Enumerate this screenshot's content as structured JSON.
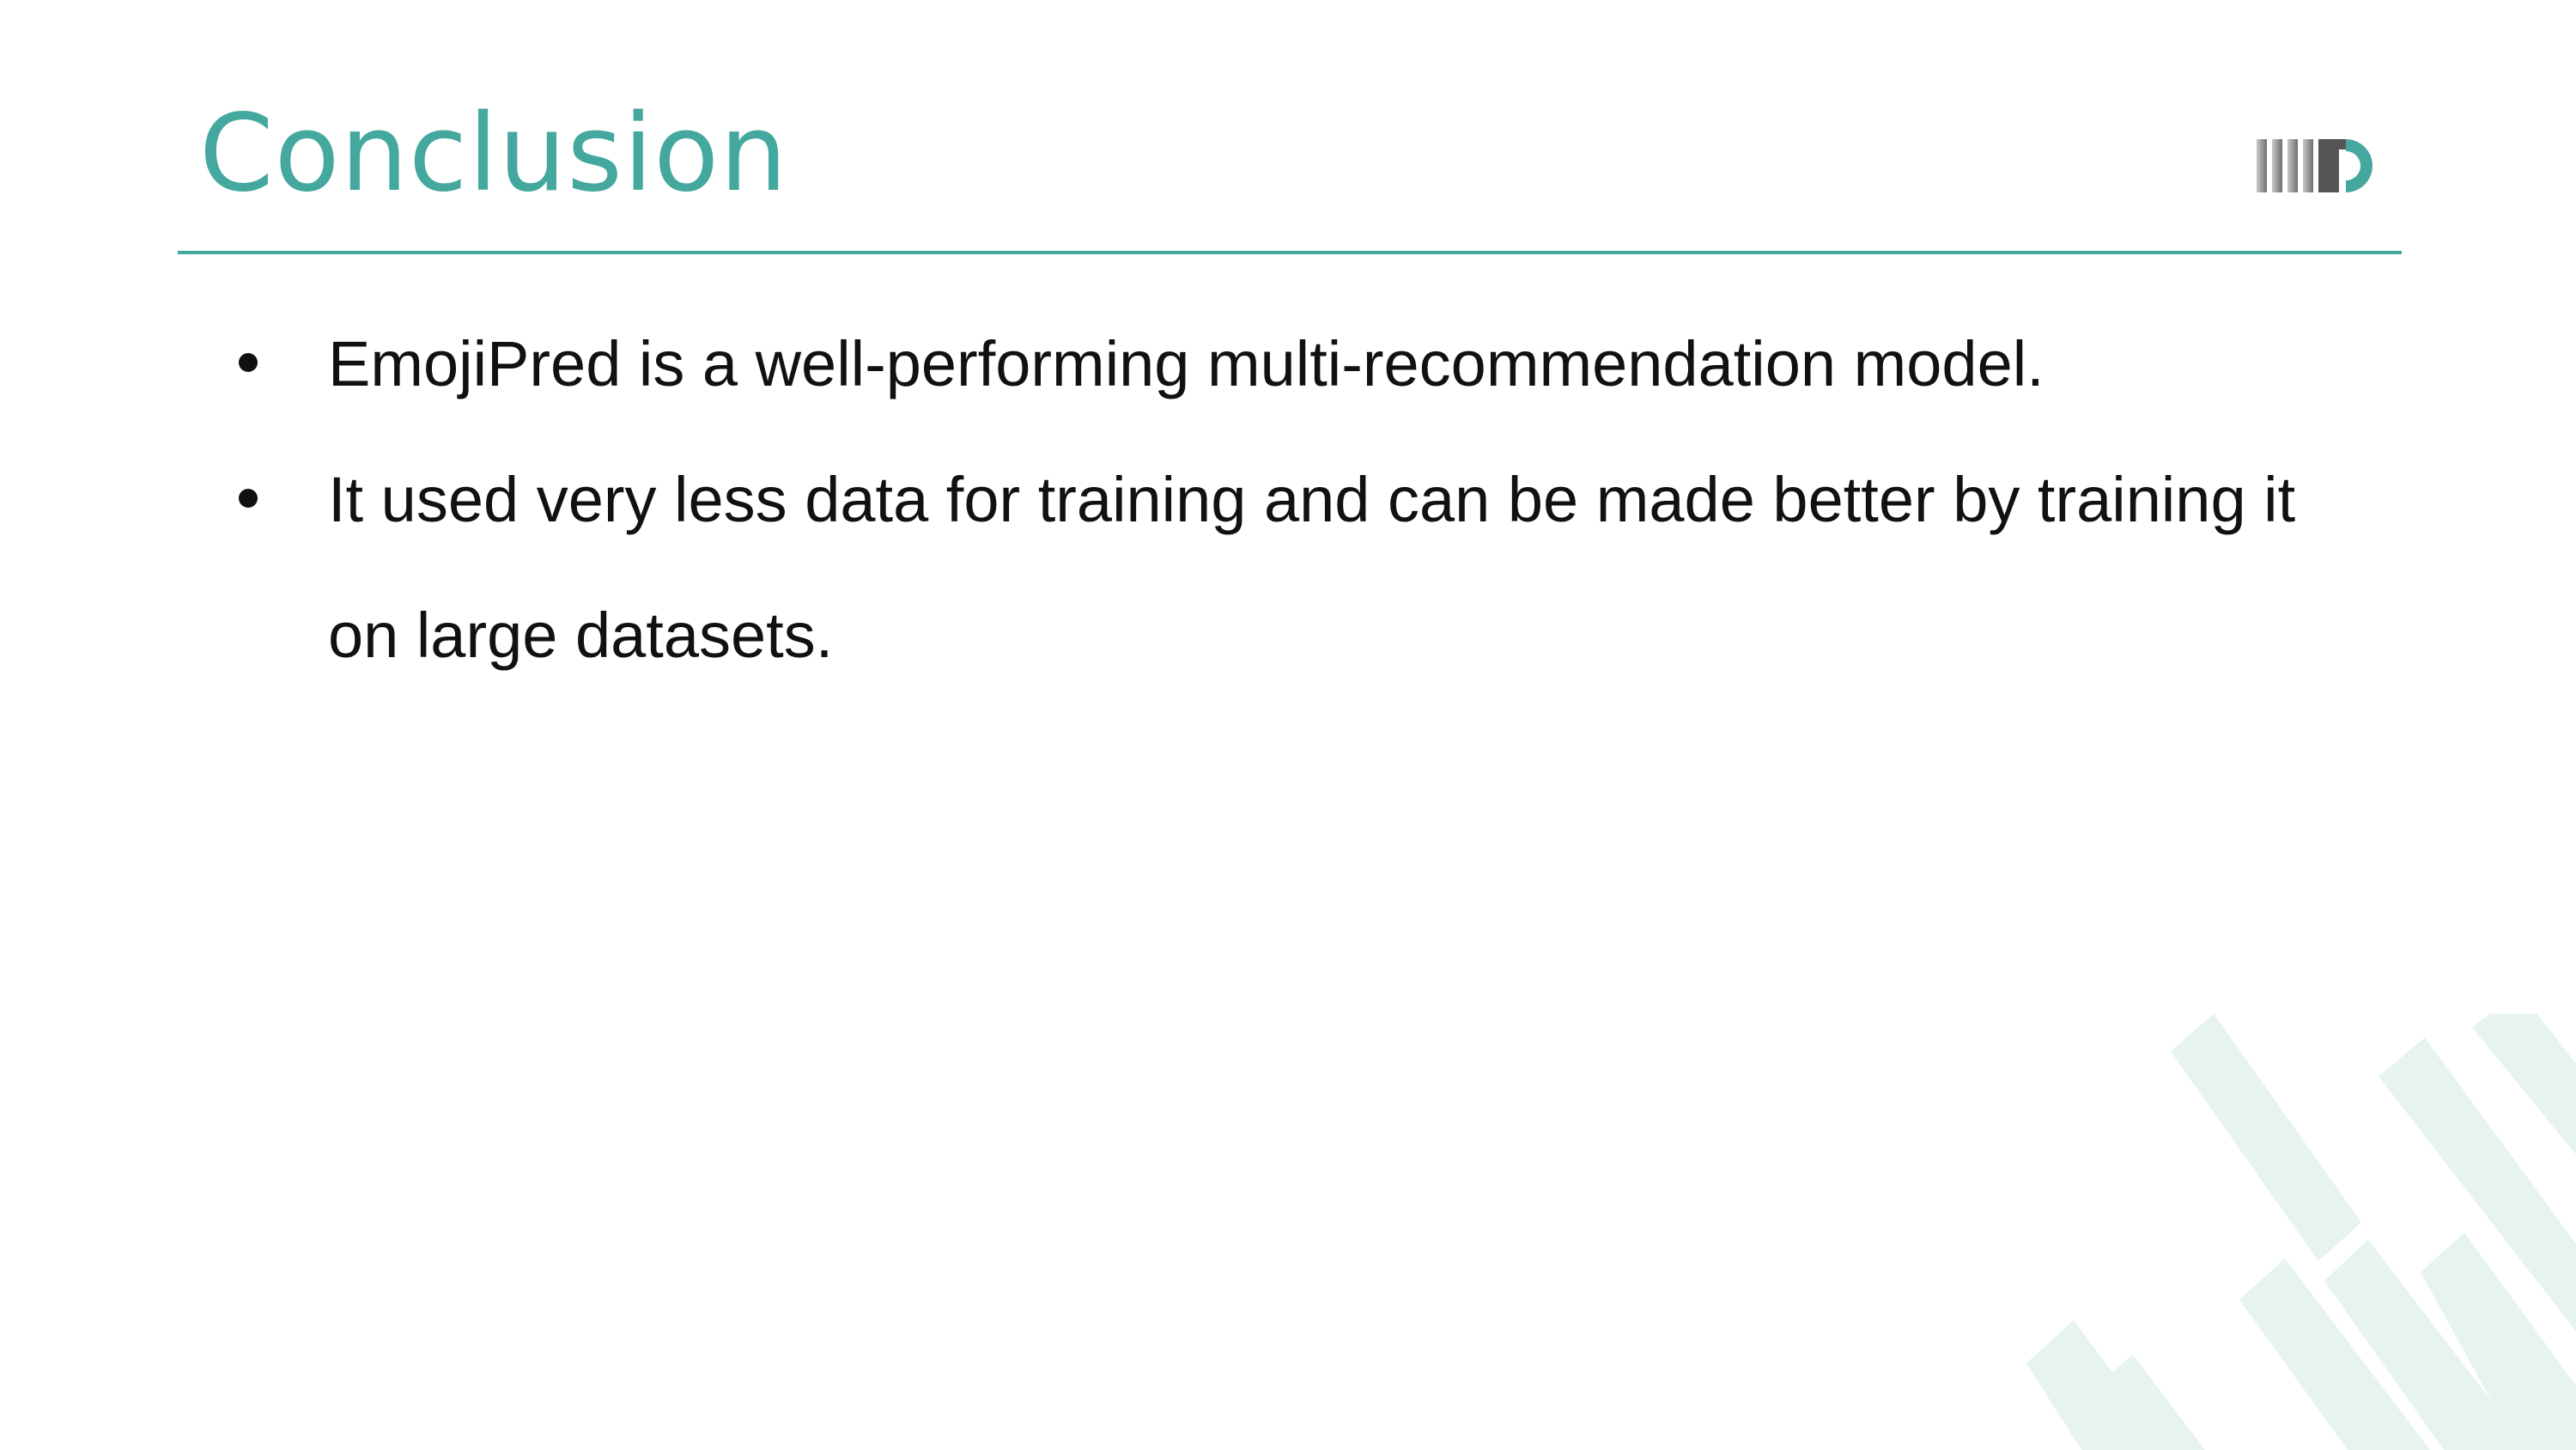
{
  "slide": {
    "title": "Conclusion",
    "bullets": [
      "EmojiPred is a well-performing multi-recommendation model.",
      "It used very less data for training and can be made better by training it on large datasets."
    ]
  },
  "colors": {
    "accent": "#45a89f",
    "text": "#111111",
    "decor": "#e6f3f1",
    "logo_gray": "#8c8c8c"
  },
  "icons": {
    "logo": "iiitd-logo",
    "bullet": "bullet-dot",
    "decor": "diagonal-stripes-decoration"
  }
}
